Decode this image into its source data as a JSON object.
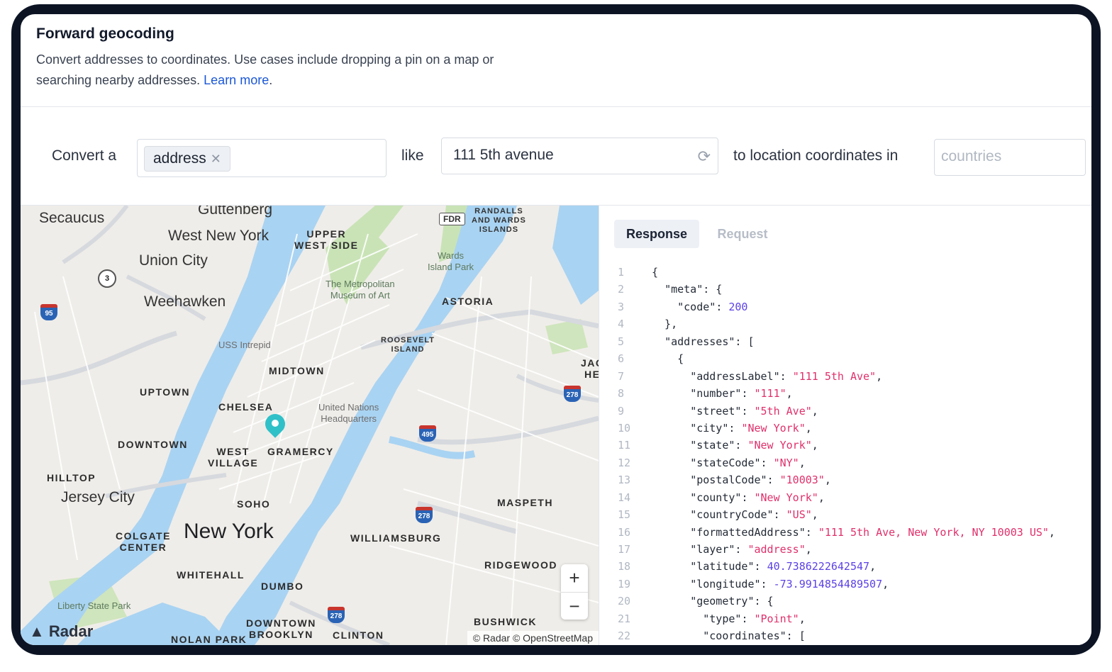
{
  "header": {
    "title": "Forward geocoding",
    "description": "Convert addresses to coordinates. Use cases include dropping a pin on a map or searching nearby addresses.",
    "learn_more": "Learn more",
    "period": "."
  },
  "converter": {
    "convert_label": "Convert a",
    "type_chip": "address",
    "like_label": "like",
    "query_value": "111 5th avenue",
    "coords_label": "to location coordinates in",
    "countries_placeholder": "countries"
  },
  "map": {
    "labels": {
      "secaucus": "Secaucus",
      "guttenberg": "Guttenberg",
      "west_new_york": "West New York",
      "union_city": "Union City",
      "weehawken": "Weehawken",
      "upper_west_side": "UPPER\nWEST SIDE",
      "randalls": "RANDALLS\nAND WARDS\nISLANDS",
      "wards_island_park": "Wards\nIsland Park",
      "met_museum": "The Metropolitan\nMuseum of Art",
      "astoria": "ASTORIA",
      "uss_intrepid": "USS Intrepid",
      "roosevelt_island": "ROOSEVELT\nISLAND",
      "midtown": "MIDTOWN",
      "uptown": "UPTOWN",
      "chelsea": "CHELSEA",
      "un_hq": "United Nations\nHeadquarters",
      "downtown": "DOWNTOWN",
      "west_village": "WEST\nVILLAGE",
      "gramercy": "GRAMERCY",
      "hilltop": "HILLTOP",
      "jersey_city": "Jersey City",
      "soho": "SOHO",
      "new_york": "New York",
      "maspeth": "MASPETH",
      "colgate_center": "COLGATE\nCENTER",
      "williamsburg": "WILLIAMSBURG",
      "whitehall": "WHITEHALL",
      "ridgewood": "RIDGEWOOD",
      "dumbo": "DUMBO",
      "liberty_state_park": "Liberty State Park",
      "downtown_brooklyn": "DOWNTOWN\nBROOKLYN",
      "clinton_hill": "CLINTON",
      "bushwick": "BUSHWICK",
      "nolan_park": "NOLAN PARK",
      "jackson_heights": "JAC\nHE"
    },
    "shields": {
      "i95": "95",
      "r3": "3",
      "i278_a": "278",
      "i495": "495",
      "i278_b": "278",
      "i278_c": "278",
      "fdr": "FDR"
    },
    "zoom_in": "+",
    "zoom_out": "−",
    "brand": "Radar",
    "attribution": "© Radar © OpenStreetMap"
  },
  "response_panel": {
    "tabs": [
      {
        "label": "Response",
        "active": true
      },
      {
        "label": "Request",
        "active": false
      }
    ],
    "code_lines": [
      [
        [
          "p",
          "{"
        ]
      ],
      [
        [
          "p",
          "  "
        ],
        [
          "k",
          "\"meta\""
        ],
        [
          "p",
          ": {"
        ]
      ],
      [
        [
          "p",
          "    "
        ],
        [
          "k",
          "\"code\""
        ],
        [
          "p",
          ": "
        ],
        [
          "n",
          "200"
        ]
      ],
      [
        [
          "p",
          "  },"
        ]
      ],
      [
        [
          "p",
          "  "
        ],
        [
          "k",
          "\"addresses\""
        ],
        [
          "p",
          ": ["
        ]
      ],
      [
        [
          "p",
          "    {"
        ]
      ],
      [
        [
          "p",
          "      "
        ],
        [
          "k",
          "\"addressLabel\""
        ],
        [
          "p",
          ": "
        ],
        [
          "s",
          "\"111 5th Ave\""
        ],
        [
          "p",
          ","
        ]
      ],
      [
        [
          "p",
          "      "
        ],
        [
          "k",
          "\"number\""
        ],
        [
          "p",
          ": "
        ],
        [
          "s",
          "\"111\""
        ],
        [
          "p",
          ","
        ]
      ],
      [
        [
          "p",
          "      "
        ],
        [
          "k",
          "\"street\""
        ],
        [
          "p",
          ": "
        ],
        [
          "s",
          "\"5th Ave\""
        ],
        [
          "p",
          ","
        ]
      ],
      [
        [
          "p",
          "      "
        ],
        [
          "k",
          "\"city\""
        ],
        [
          "p",
          ": "
        ],
        [
          "s",
          "\"New York\""
        ],
        [
          "p",
          ","
        ]
      ],
      [
        [
          "p",
          "      "
        ],
        [
          "k",
          "\"state\""
        ],
        [
          "p",
          ": "
        ],
        [
          "s",
          "\"New York\""
        ],
        [
          "p",
          ","
        ]
      ],
      [
        [
          "p",
          "      "
        ],
        [
          "k",
          "\"stateCode\""
        ],
        [
          "p",
          ": "
        ],
        [
          "s",
          "\"NY\""
        ],
        [
          "p",
          ","
        ]
      ],
      [
        [
          "p",
          "      "
        ],
        [
          "k",
          "\"postalCode\""
        ],
        [
          "p",
          ": "
        ],
        [
          "s",
          "\"10003\""
        ],
        [
          "p",
          ","
        ]
      ],
      [
        [
          "p",
          "      "
        ],
        [
          "k",
          "\"county\""
        ],
        [
          "p",
          ": "
        ],
        [
          "s",
          "\"New York\""
        ],
        [
          "p",
          ","
        ]
      ],
      [
        [
          "p",
          "      "
        ],
        [
          "k",
          "\"countryCode\""
        ],
        [
          "p",
          ": "
        ],
        [
          "s",
          "\"US\""
        ],
        [
          "p",
          ","
        ]
      ],
      [
        [
          "p",
          "      "
        ],
        [
          "k",
          "\"formattedAddress\""
        ],
        [
          "p",
          ": "
        ],
        [
          "s",
          "\"111 5th Ave, New York, NY 10003 US\""
        ],
        [
          "p",
          ","
        ]
      ],
      [
        [
          "p",
          "      "
        ],
        [
          "k",
          "\"layer\""
        ],
        [
          "p",
          ": "
        ],
        [
          "s",
          "\"address\""
        ],
        [
          "p",
          ","
        ]
      ],
      [
        [
          "p",
          "      "
        ],
        [
          "k",
          "\"latitude\""
        ],
        [
          "p",
          ": "
        ],
        [
          "n",
          "40.7386222642547"
        ],
        [
          "p",
          ","
        ]
      ],
      [
        [
          "p",
          "      "
        ],
        [
          "k",
          "\"longitude\""
        ],
        [
          "p",
          ": "
        ],
        [
          "n",
          "-73.9914854489507"
        ],
        [
          "p",
          ","
        ]
      ],
      [
        [
          "p",
          "      "
        ],
        [
          "k",
          "\"geometry\""
        ],
        [
          "p",
          ": {"
        ]
      ],
      [
        [
          "p",
          "        "
        ],
        [
          "k",
          "\"type\""
        ],
        [
          "p",
          ": "
        ],
        [
          "s",
          "\"Point\""
        ],
        [
          "p",
          ","
        ]
      ],
      [
        [
          "p",
          "        "
        ],
        [
          "k",
          "\"coordinates\""
        ],
        [
          "p",
          ": ["
        ]
      ]
    ]
  }
}
